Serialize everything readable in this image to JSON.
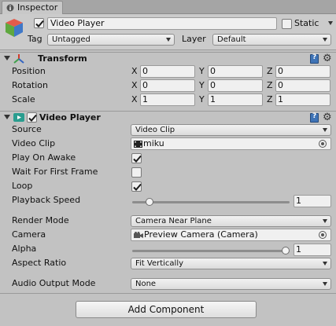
{
  "tab": {
    "label": "Inspector"
  },
  "header": {
    "active": true,
    "name": "Video Player",
    "static_label": "Static",
    "tag_label": "Tag",
    "tag_value": "Untagged",
    "layer_label": "Layer",
    "layer_value": "Default"
  },
  "transform": {
    "title": "Transform",
    "rows": [
      {
        "label": "Position",
        "x": "0",
        "y": "0",
        "z": "0"
      },
      {
        "label": "Rotation",
        "x": "0",
        "y": "0",
        "z": "0"
      },
      {
        "label": "Scale",
        "x": "1",
        "y": "1",
        "z": "1"
      }
    ],
    "axes": {
      "x": "X",
      "y": "Y",
      "z": "Z"
    }
  },
  "video_player": {
    "title": "Video Player",
    "enabled": true,
    "source_label": "Source",
    "source_value": "Video Clip",
    "video_clip_label": "Video Clip",
    "video_clip_value": "miku",
    "play_on_awake_label": "Play On Awake",
    "play_on_awake": true,
    "wait_first_frame_label": "Wait For First Frame",
    "wait_first_frame": false,
    "loop_label": "Loop",
    "loop": true,
    "playback_speed_label": "Playback Speed",
    "playback_speed_value": "1",
    "playback_speed_fraction": 0.09,
    "render_mode_label": "Render Mode",
    "render_mode_value": "Camera Near Plane",
    "camera_label": "Camera",
    "camera_value": "Preview Camera (Camera)",
    "alpha_label": "Alpha",
    "alpha_value": "1",
    "alpha_fraction": 1.0,
    "aspect_ratio_label": "Aspect Ratio",
    "aspect_ratio_value": "Fit Vertically",
    "audio_output_label": "Audio Output Mode",
    "audio_output_value": "None"
  },
  "add_component": {
    "label": "Add Component"
  },
  "colors": {
    "accent_blue": "#3e73b6",
    "checkbox_check": "#1b1b1b",
    "background": "#c2c2c2"
  }
}
